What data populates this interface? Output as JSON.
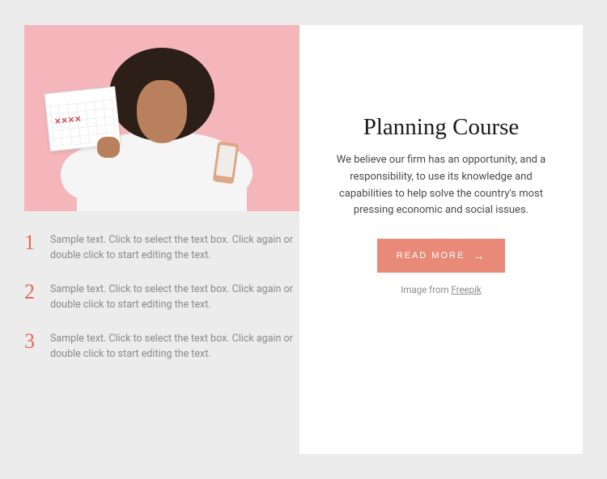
{
  "left": {
    "list": [
      {
        "num": "1",
        "text": "Sample text. Click to select the text box. Click again or double click to start editing the text."
      },
      {
        "num": "2",
        "text": "Sample text. Click to select the text box. Click again or double click to start editing the text."
      },
      {
        "num": "3",
        "text": "Sample text. Click to select the text box. Click again or double click to start editing the text."
      }
    ]
  },
  "right": {
    "title": "Planning Course",
    "body": "We believe our firm has an opportunity, and a responsibility, to use its knowledge and capabilities to help solve the country's most pressing economic and social issues.",
    "button_label": "READ MORE",
    "credit_prefix": "Image from ",
    "credit_link": "Freepik"
  }
}
